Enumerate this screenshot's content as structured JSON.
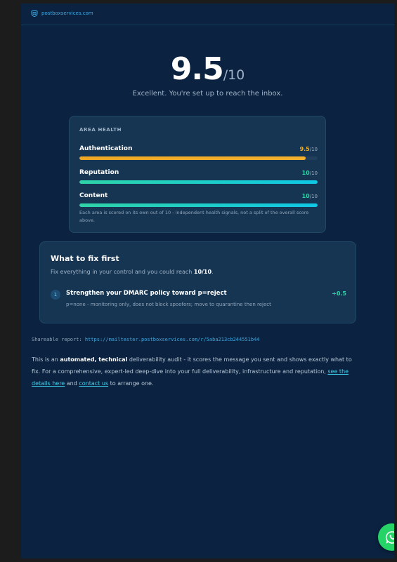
{
  "brand": {
    "name": "postboxservices.com",
    "icon": "shield-mail-icon"
  },
  "score": {
    "value": "9.5",
    "max": "/10",
    "verdict": "Excellent. You're set up to reach the inbox."
  },
  "health": {
    "title": "AREA HEALTH",
    "metrics": [
      {
        "label": "Authentication",
        "score": "9.5",
        "max": "/10",
        "fraction": 0.95,
        "color": "#f0a824"
      },
      {
        "label": "Reputation",
        "score": "10",
        "max": "/10",
        "fraction": 1.0,
        "color": "#2fd3a8"
      },
      {
        "label": "Content",
        "score": "10",
        "max": "/10",
        "fraction": 1.0,
        "color": "#2fd3a8"
      }
    ],
    "note": "Each area is scored on its own out of 10 - independent health signals, not a split of the overall score above."
  },
  "fix": {
    "title": "What to fix first",
    "subtitle_prefix": "Fix everything in your control and you could reach ",
    "subtitle_target": "10/10",
    "subtitle_suffix": ".",
    "items": [
      {
        "number": "1",
        "title": "Strengthen your DMARC policy toward p=reject",
        "description": "p=none - monitoring only, does not block spoofers; move to quarantine then reject",
        "gain": "+0.5"
      }
    ]
  },
  "share": {
    "label": "Shareable report:",
    "url": "https://mailtester.postboxservices.com/r/5aba213cb244551b44"
  },
  "disclaimer": {
    "p1": "This is an ",
    "b1": "automated, technical",
    "p2": " deliverability audit - it scores the message you sent and shows exactly what to fix. For a comprehensive, expert-led deep-dive into your full deliverability, infrastructure and reputation, ",
    "link1": "see the details here",
    "p3": " and ",
    "link2": "contact us",
    "p4": " to arrange one."
  },
  "chat": {
    "icon": "whatsapp-icon"
  }
}
